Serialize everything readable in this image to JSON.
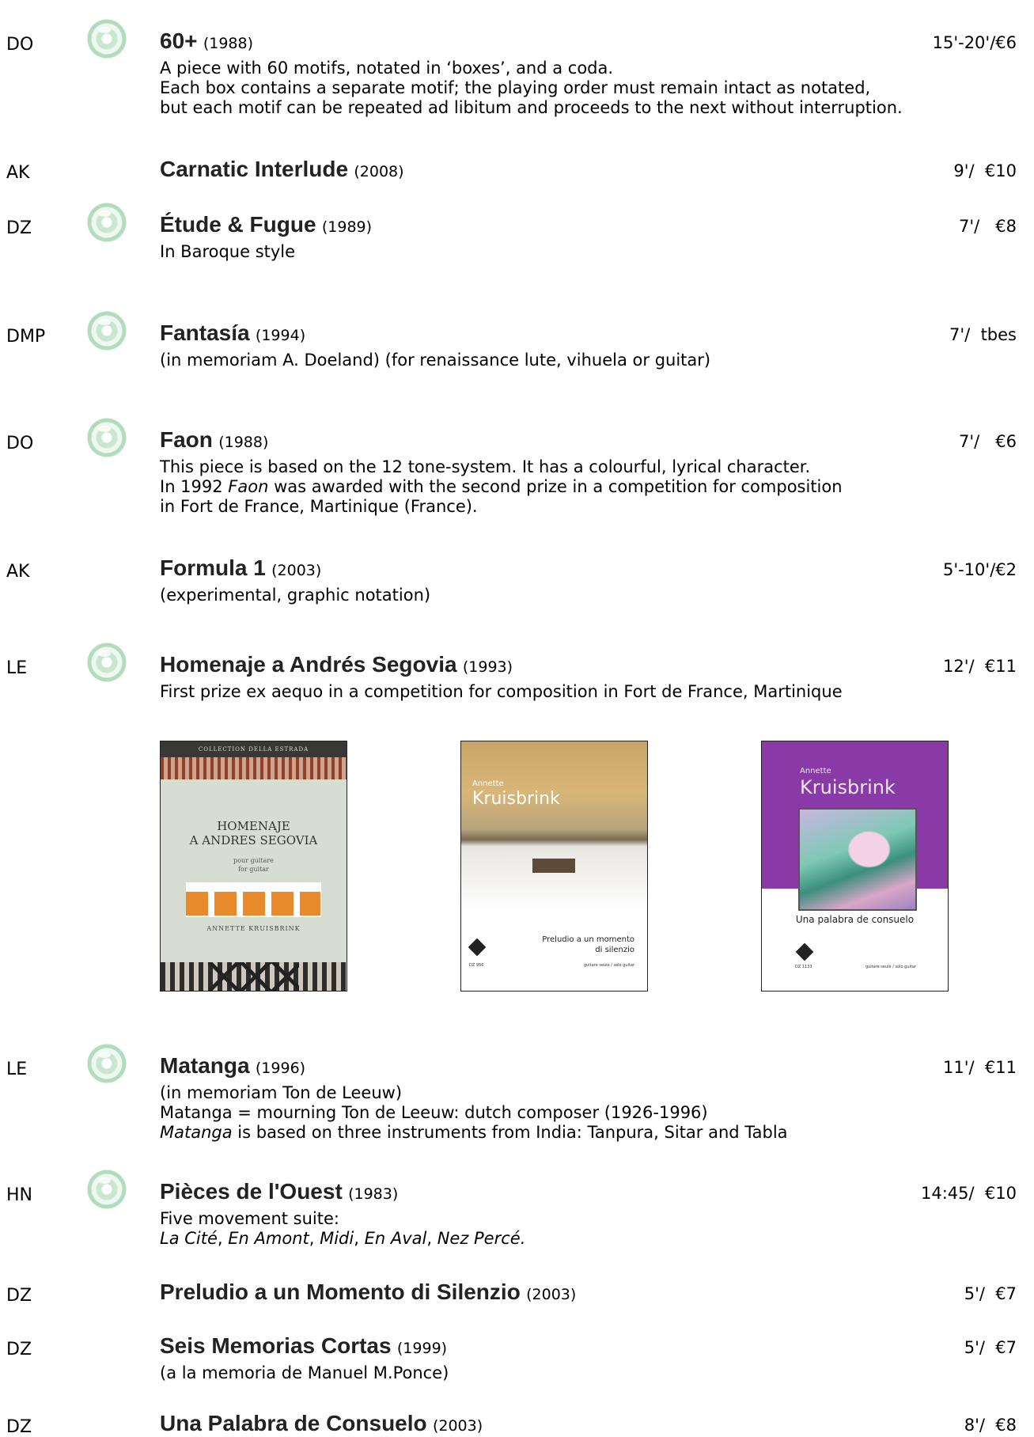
{
  "entries": [
    {
      "pub": "DO",
      "cd": true,
      "title": "60+",
      "year": "(1988)",
      "duration": "15'-20'/€6",
      "desc": [
        "A piece with 60 motifs, notated in ‘boxes’, and a coda.",
        "Each box contains a separate motif; the playing order must remain intact as notated,",
        "but each motif can be repeated ad libitum and proceeds to the next without interruption."
      ]
    },
    {
      "pub": "AK",
      "cd": false,
      "title": "Carnatic Interlude",
      "year": "(2008)",
      "duration": "9'/  €10",
      "desc": []
    },
    {
      "pub": "DZ",
      "cd": true,
      "title": "Étude & Fugue",
      "year": "(1989)",
      "duration": "7'/   €8",
      "desc": [
        "In Baroque style"
      ]
    },
    {
      "pub": "DMP",
      "cd": true,
      "title": "Fantasía",
      "year": "(1994)",
      "duration": "7'/  tbes",
      "desc": [
        " (in memoriam A. Doeland) (for renaissance lute, vihuela or guitar)"
      ]
    },
    {
      "pub": "DO",
      "cd": true,
      "title": "Faon",
      "year": "(1988)",
      "duration": "7'/   €6",
      "desc": [
        "This piece is based on the 12 tone-system. It has a colourful, lyrical character."
      ],
      "desc_faon": {
        "pre": "In 1992 ",
        "it": "Faon",
        "post": " was awarded with the second prize in a competition for composition"
      },
      "desc_tail": "in Fort de France, Martinique (France)."
    },
    {
      "pub": "AK",
      "cd": false,
      "title": "Formula 1",
      "year": "(2003)",
      "duration": "5'-10'/€2",
      "desc": [
        "(experimental, graphic notation)"
      ]
    },
    {
      "pub": "LE",
      "cd": true,
      "title": "Homenaje a Andrés Segovia",
      "year": "(1993)",
      "duration": "12'/  €11",
      "desc": [
        "First prize ex aequo in a competition for composition in Fort de France, Martinique"
      ]
    },
    {
      "pub": "LE",
      "cd": true,
      "title": "Matanga",
      "year": "(1996)",
      "duration": "11'/  €11",
      "desc": [
        "(in memoriam Ton de Leeuw)",
        "Matanga = mourning  Ton de Leeuw: dutch composer (1926-1996)"
      ],
      "desc_it": {
        "it": "Matanga",
        "post": " is based on three instruments from India: Tanpura, Sitar and Tabla"
      }
    },
    {
      "pub": "HN",
      "cd": true,
      "title": "Pièces de l'Ouest",
      "year": "(1983)",
      "duration": "14:45/  €10",
      "desc": [
        "Five movement suite:"
      ],
      "movements": [
        "La Cité",
        ", ",
        "En Amont",
        ", ",
        "Midi",
        ", ",
        "En Aval",
        ", ",
        "Nez Percé",
        "."
      ]
    },
    {
      "pub": "DZ",
      "cd": false,
      "title": "Preludio a un Momento di Silenzio",
      "year": "(2003)",
      "duration": "5'/  €7",
      "desc": []
    },
    {
      "pub": "DZ",
      "cd": false,
      "title": "Seis Memorias Cortas",
      "year": "(1999)",
      "duration": "5'/  €7",
      "desc": [
        "(a la memoria de Manuel M.Ponce)"
      ]
    },
    {
      "pub": "DZ",
      "cd": false,
      "title": "Una Palabra de Consuelo",
      "year": "(2003)",
      "duration": "8'/  €8",
      "desc": []
    }
  ],
  "covers": {
    "homenaje": {
      "band": "COLLECTION DELLA ESTRADA",
      "title1": "HOMENAJE",
      "title2": "A ANDRES SEGOVIA",
      "sub1": "pour guitare",
      "sub2": "for guitar",
      "author": "ANNETTE KRUISBRINK"
    },
    "preludio": {
      "first": "Annette",
      "last": "Kruisbrink",
      "title1": "Preludio a un momento",
      "title2": "di silenzio",
      "code": "DZ 956",
      "small": "guitare seule / solo guitar"
    },
    "palabra": {
      "first": "Annette",
      "last": "Kruisbrink",
      "title": "Una palabra de consuelo",
      "code": "DZ 1133",
      "small": "guitare seule / solo guitar"
    }
  }
}
